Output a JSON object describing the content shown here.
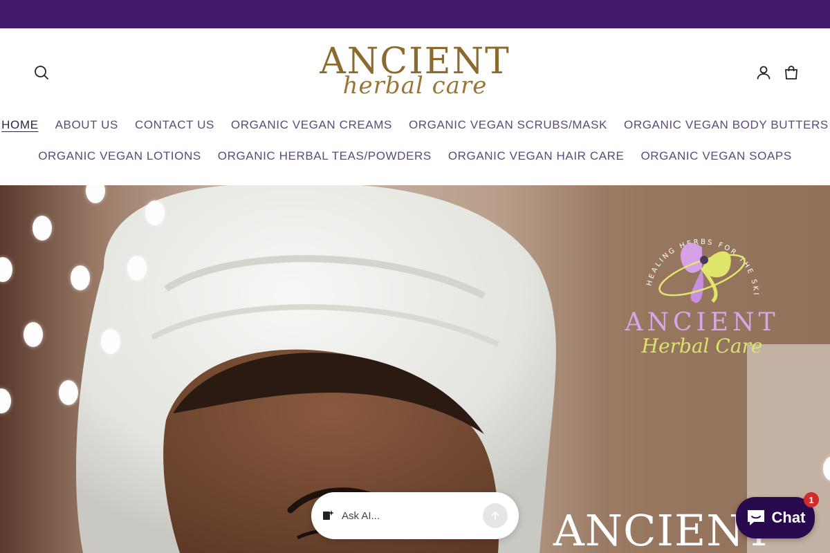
{
  "header": {
    "logo_main": "ANCIENT",
    "logo_sub": "herbal care"
  },
  "icons": {
    "search": "search-icon",
    "account": "account-icon",
    "cart": "cart-icon"
  },
  "nav": {
    "row1": [
      {
        "label": "HOME",
        "active": true
      },
      {
        "label": "ABOUT US"
      },
      {
        "label": "CONTACT US"
      },
      {
        "label": "ORGANIC VEGAN CREAMS"
      },
      {
        "label": "ORGANIC VEGAN SCRUBS/MASK"
      },
      {
        "label": "ORGANIC VEGAN BODY BUTTERS"
      }
    ],
    "row2": [
      {
        "label": "ORGANIC VEGAN LOTIONS"
      },
      {
        "label": "ORGANIC HERBAL TEAS/POWDERS"
      },
      {
        "label": "ORGANIC VEGAN HAIR CARE"
      },
      {
        "label": "ORGANIC VEGAN SOAPS"
      }
    ]
  },
  "hero": {
    "brand_ring_text": "HEALING HERBS FOR THE SKIN",
    "brand_ancient": "ANCIENT",
    "brand_herbal": "Herbal Care",
    "heading": "ANCIENT"
  },
  "ask_ai": {
    "placeholder": "Ask AI..."
  },
  "chat": {
    "label": "Chat",
    "badge": "1"
  },
  "colors": {
    "announcement_bar": "#43196b",
    "nav_text": "#5b4a7a",
    "logo_gold": "#8c6a2e",
    "chat_button": "#2a0a4e"
  }
}
